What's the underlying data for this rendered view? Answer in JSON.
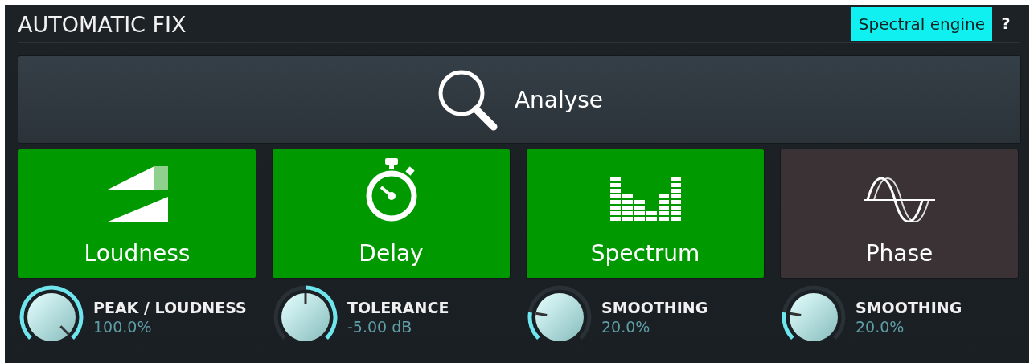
{
  "title": "AUTOMATIC FIX",
  "engine_button": {
    "label": "Spectral engine",
    "on": true
  },
  "help": "?",
  "analyse": {
    "label": "Analyse"
  },
  "modules": [
    {
      "kind": "loudness",
      "label": "Loudness",
      "on": true,
      "knob": {
        "name": "PEAK / LOUDNESS",
        "value": "100.0%",
        "level": 1,
        "kind": "normal"
      }
    },
    {
      "kind": "delay",
      "label": "Delay",
      "on": true,
      "knob": {
        "name": "TOLERANCE",
        "value": "-5.00 dB",
        "level": 0.5,
        "kind": "reverse"
      }
    },
    {
      "kind": "spectrum",
      "label": "Spectrum",
      "on": true,
      "knob": {
        "name": "SMOOTHING",
        "value": "20.0%",
        "level": 0.2,
        "kind": "normal"
      }
    },
    {
      "kind": "phase",
      "label": "Phase",
      "on": false,
      "knob": {
        "name": "SMOOTHING",
        "value": "20.0%",
        "level": 0.2,
        "kind": "normal"
      }
    }
  ]
}
